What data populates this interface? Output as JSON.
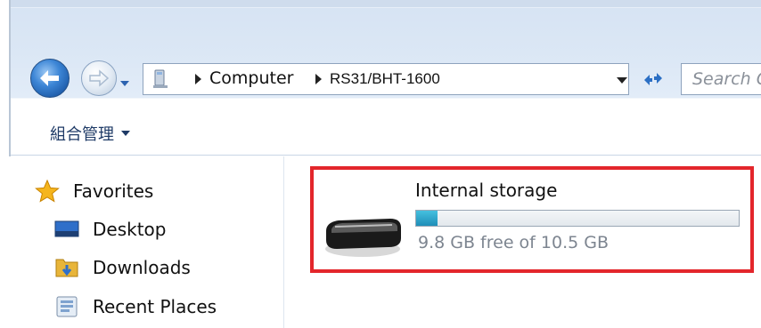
{
  "colors": {
    "window_chrome": "#d6e3f3",
    "highlight_border": "#e3262b",
    "storage_bar_fill": "#1f8eb8",
    "accent_blue": "#3d86d6"
  },
  "navigation": {
    "back_icon": "back-arrow-icon",
    "forward_icon": "forward-arrow-icon",
    "history_icon": "chevron-down-icon",
    "breadcrumb": [
      "Computer",
      "RS31/BHT-1600"
    ],
    "refresh_icon": "refresh-icon",
    "search_placeholder": "Search C"
  },
  "toolbar": {
    "organize_label": "組合管理"
  },
  "sidebar": {
    "items": [
      {
        "label": "Favorites",
        "icon": "star-icon"
      },
      {
        "label": "Desktop",
        "icon": "desktop-icon"
      },
      {
        "label": "Downloads",
        "icon": "downloads-folder-icon"
      },
      {
        "label": "Recent Places",
        "icon": "recent-places-icon"
      }
    ]
  },
  "drive": {
    "name": "Internal storage",
    "free_text": "9.8 GB free of 10.5 GB",
    "used_fraction": 0.067,
    "icon": "drive-icon"
  }
}
